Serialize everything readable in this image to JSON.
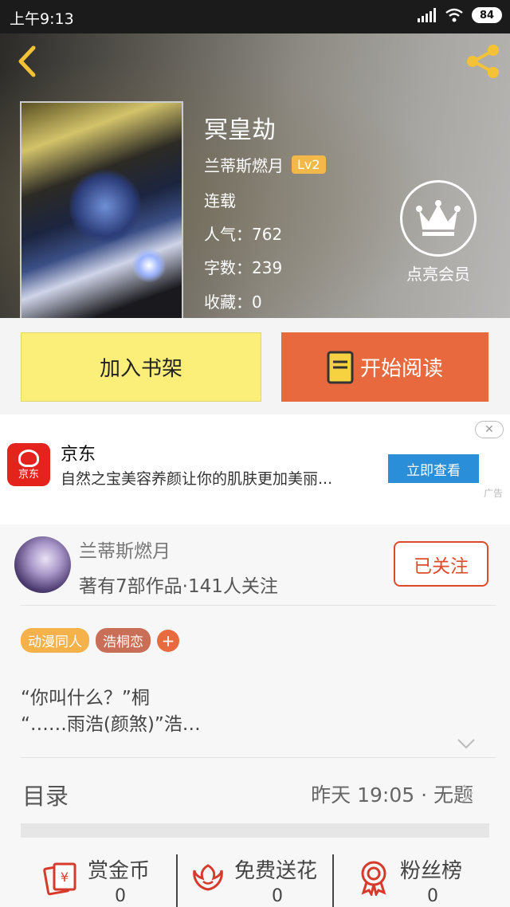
{
  "status_bar": {
    "time": "上午9:13",
    "battery": "84"
  },
  "book": {
    "title": "冥皇劫",
    "author": "兰蒂斯燃月",
    "level": "Lv2",
    "status": "连载",
    "popularity": "人气：762",
    "word_count": "字数：239",
    "favorites": "收藏：0"
  },
  "vip": {
    "label": "点亮会员"
  },
  "actions": {
    "add_shelf": "加入书架",
    "start_read": "开始阅读"
  },
  "ad": {
    "brand": "京东",
    "logo_text": "京东",
    "description": "自然之宝美容养颜让你的肌肤更加美丽...",
    "cta": "立即查看",
    "tag": "广告"
  },
  "author_card": {
    "name": "兰蒂斯燃月",
    "stats": "著有7部作品·141人关注",
    "follow": "已关注"
  },
  "tags": [
    "动漫同人",
    "浩桐恋"
  ],
  "tag_add": "+",
  "description_lines": [
    "“你叫什么？”桐",
    "“……雨浩(颜煞)”浩…"
  ],
  "toc": {
    "label": "目录",
    "latest": "昨天 19:05 · 无题"
  },
  "bottom_stats": [
    {
      "label": "赏金币",
      "value": "0",
      "icon": "red-envelope-icon"
    },
    {
      "label": "免费送花",
      "value": "0",
      "icon": "flower-icon"
    },
    {
      "label": "粉丝榜",
      "value": "0",
      "icon": "medal-icon"
    }
  ],
  "colors": {
    "read_button": "#e9693e",
    "shelf_button": "#fbef79",
    "accent_red": "#e04a2c",
    "ad_cta": "#2a8fd8"
  }
}
